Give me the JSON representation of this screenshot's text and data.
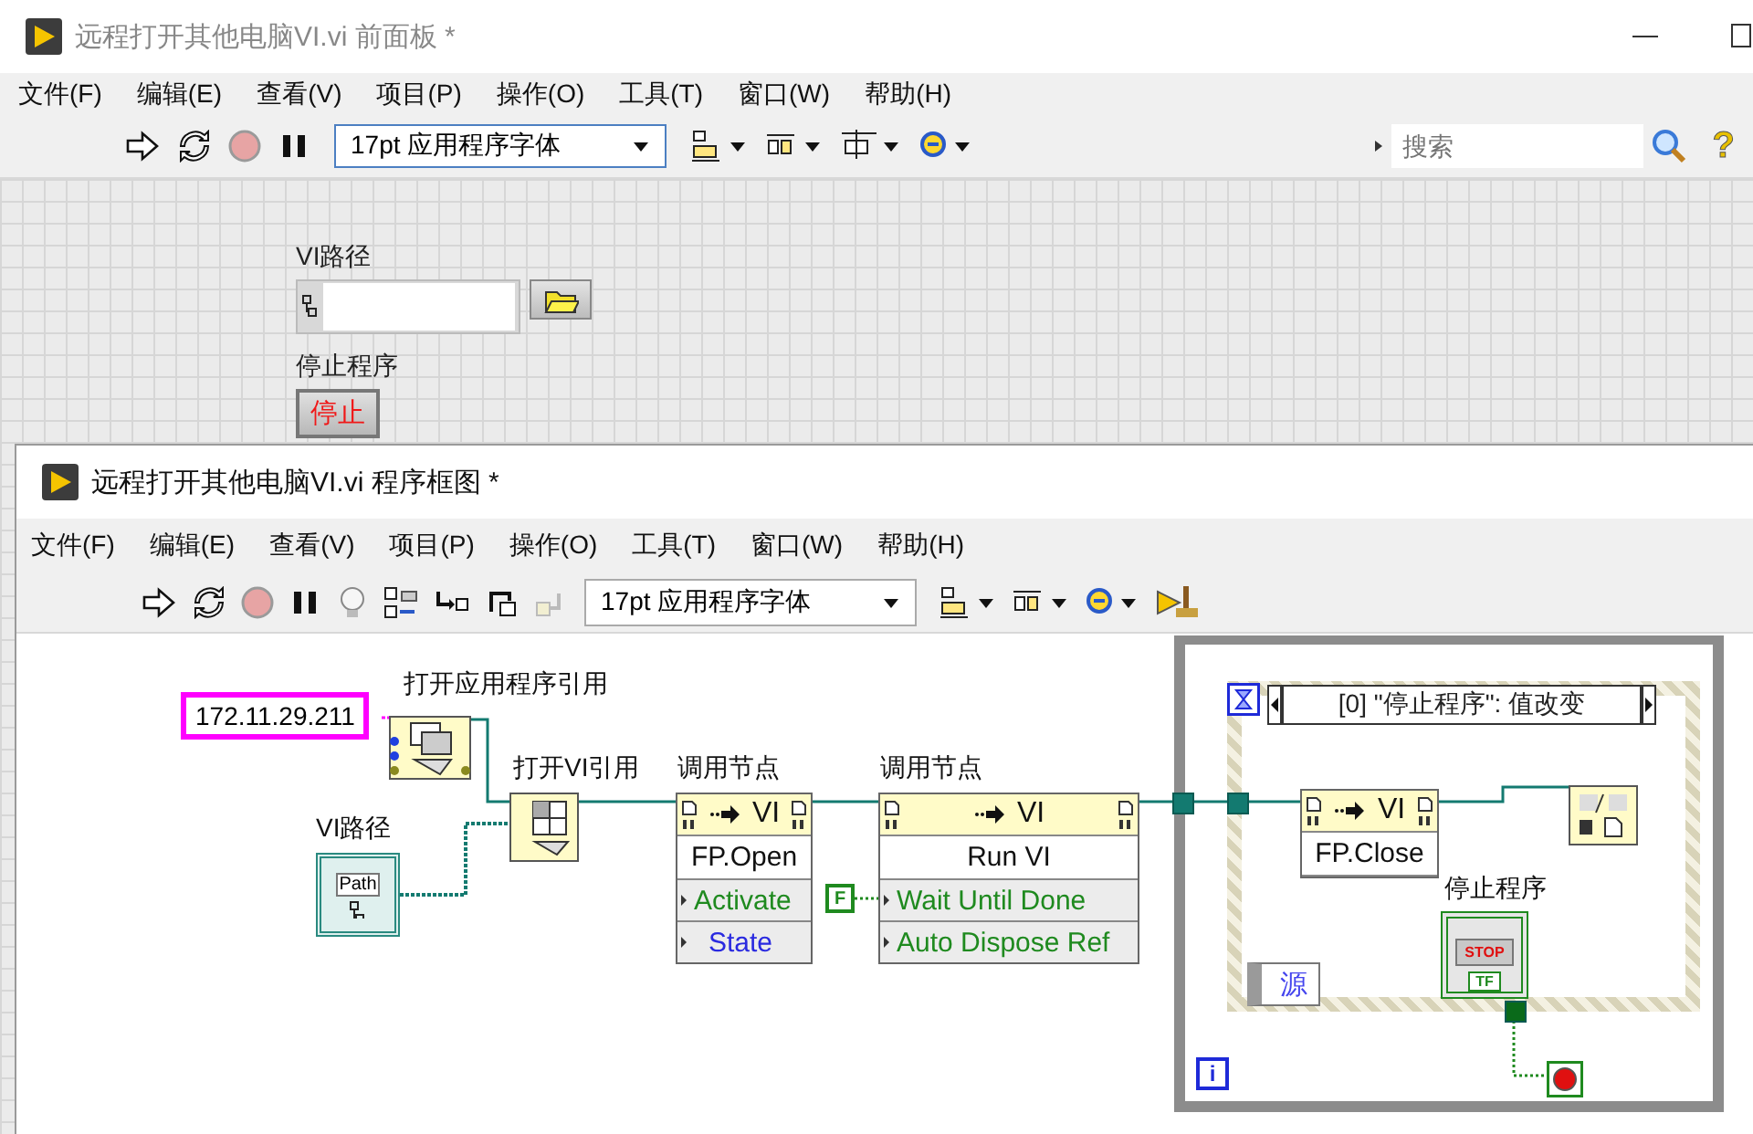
{
  "front_panel": {
    "title": "远程打开其他电脑VI.vi 前面板 *",
    "menu": [
      "文件(F)",
      "编辑(E)",
      "查看(V)",
      "项目(P)",
      "操作(O)",
      "工具(T)",
      "窗口(W)",
      "帮助(H)"
    ],
    "font_menu": "17pt 应用程序字体",
    "search": {
      "placeholder": "搜索"
    },
    "help": "?",
    "path_control": {
      "label": "VI路径"
    },
    "stop_button": {
      "label": "停止程序",
      "text": "停止"
    }
  },
  "block_diagram": {
    "title": "远程打开其他电脑VI.vi 程序框图 *",
    "menu": [
      "文件(F)",
      "编辑(E)",
      "查看(V)",
      "项目(P)",
      "操作(O)",
      "工具(T)",
      "窗口(W)",
      "帮助(H)"
    ],
    "font_menu": "17pt 应用程序字体",
    "ip_constant": "172.11.29.211",
    "open_nodes": [
      {
        "kind": "open_app_ref",
        "label": "打开应用程序引用"
      },
      {
        "kind": "open_vi_ref",
        "label": "打开VI引用"
      }
    ],
    "path_terminal": {
      "label": "VI路径",
      "text": "Path"
    },
    "invoke_nodes": [
      {
        "label": "调用节点",
        "header": "VI",
        "method": "FP.Open",
        "params": [
          {
            "name": "Activate",
            "kind": "boolean"
          },
          {
            "name": "State",
            "kind": "enum"
          }
        ]
      },
      {
        "label": "调用节点",
        "header": "VI",
        "method": "Run VI",
        "params": [
          {
            "name": "Wait Until Done",
            "kind": "boolean"
          },
          {
            "name": "Auto Dispose Ref",
            "kind": "boolean"
          }
        ]
      }
    ],
    "false_constant": "F",
    "while_loop": {
      "iteration": "i"
    },
    "event_structure": {
      "selector": "[0] \"停止程序\": 值改变",
      "source": "源",
      "invoke": {
        "header": "VI",
        "method": "FP.Close"
      },
      "stop_terminal": {
        "label": "停止程序",
        "text": "STOP",
        "type_text": "TF"
      }
    }
  }
}
